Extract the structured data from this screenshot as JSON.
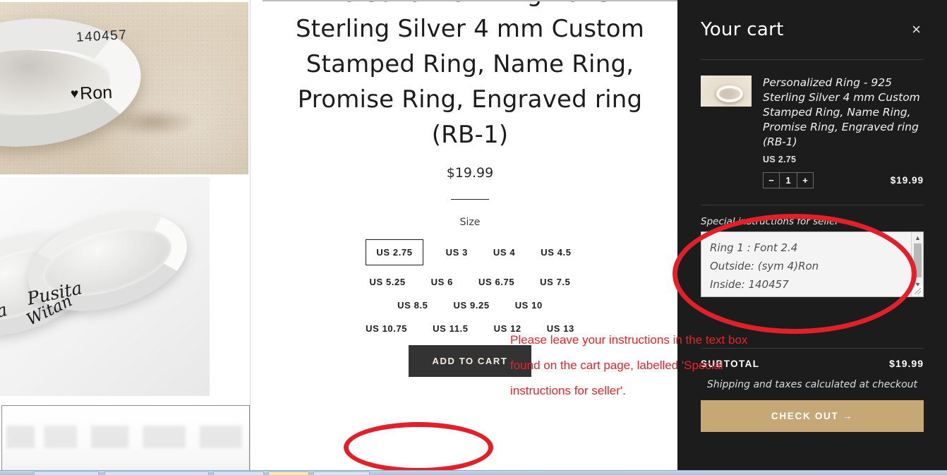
{
  "gallery": {
    "photo1": {
      "alt": "silver-ring-on-sand",
      "engraving_inside": "140457",
      "engraving_outside": "Ron",
      "heart_glyph": "♥"
    },
    "photo2": {
      "alt": "two-engraved-script-rings",
      "script_left": "Pusita",
      "script_mid": "Pusita",
      "script_right": "Witan"
    },
    "photo3": {
      "alt": "blank-product-photo"
    }
  },
  "product": {
    "title": "Personalized Ring - 925 Sterling Silver 4 mm Custom Stamped Ring, Name Ring, Promise Ring, Engraved ring (RB-1)",
    "price": "$19.99",
    "size_label": "Size",
    "sizes": [
      [
        "US 2.75",
        "US 3",
        "US 4",
        "US 4.5"
      ],
      [
        "US 5.25",
        "US 6",
        "US 6.75",
        "US 7.5"
      ],
      [
        "US 8.5",
        "US 9.25",
        "US 10"
      ],
      [
        "US 10.75",
        "US 11.5",
        "US 12",
        "US 13"
      ]
    ],
    "selected_size": "US 2.75",
    "add_to_cart_label": "ADD TO CART"
  },
  "cart": {
    "title": "Your cart",
    "close_glyph": "×",
    "item": {
      "title": "Personalized Ring - 925 Sterling Silver 4 mm Custom Stamped Ring, Name Ring, Promise Ring, Engraved ring (RB-1)",
      "variant": "US 2.75",
      "qty_minus": "−",
      "qty_value": "1",
      "qty_plus": "+",
      "line_price": "$19.99"
    },
    "notes_label": "Special instructions for seller",
    "notes_value": "Ring 1 : Font 2.4\nOutside: (sym 4)Ron\nInside: 140457",
    "scroll_up_glyph": "▲",
    "scroll_down_glyph": "▼",
    "subtotal_label": "SUBTOTAL",
    "subtotal_value": "$19.99",
    "shipping_note": "Shipping and taxes calculated at checkout",
    "checkout_label": "CHECK OUT →",
    "accent_color": "#c6a877",
    "panel_color": "#1c1c1c"
  },
  "annotation": {
    "text": "Please leave your instructions in the text box\nfound on the cart page, labelled 'Special\ninstructions for seller'.",
    "color": "#e2202a"
  }
}
